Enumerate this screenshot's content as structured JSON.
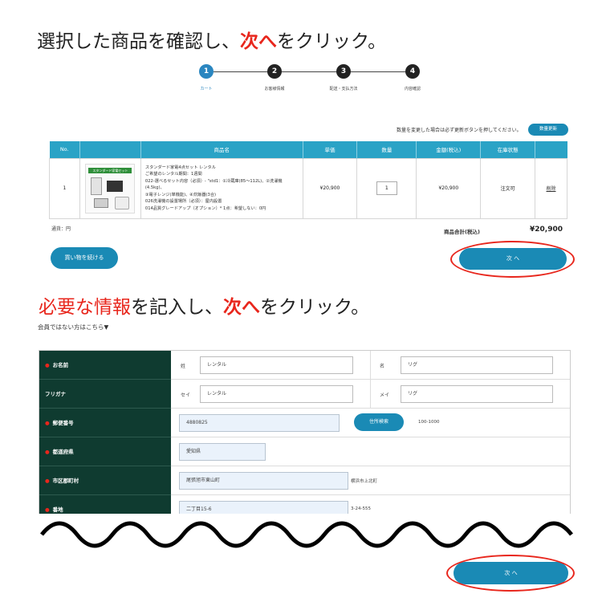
{
  "instruction1": {
    "pre": "選択した商品を確認し、",
    "highlight": "次へ",
    "post": "をクリック。"
  },
  "stepper": [
    {
      "num": "1",
      "label": "カート",
      "active": true
    },
    {
      "num": "2",
      "label": "お客様情報",
      "active": false
    },
    {
      "num": "3",
      "label": "配送・支払方法",
      "active": false
    },
    {
      "num": "4",
      "label": "内容確認",
      "active": false
    }
  ],
  "cart": {
    "update_note": "数量を変更した場合は必ず更新ボタンを押してください。",
    "update_button": "数量更新",
    "headers": [
      "No.",
      "",
      "商品名",
      "単価",
      "数量",
      "金額(税込)",
      "在庫状態",
      ""
    ],
    "row": {
      "no": "1",
      "image_label": "スタンダード家電セット",
      "description": [
        "スタンダード家電4点セット レンタル",
        "ご希望のレンタル期間：1週間",
        "022-選べるセット内容（必須）- \"std1：①冷蔵庫(85〜112L)、②洗濯機(4.5kg)、",
        "③電子レンジ(単機能)、④炊飯器(3合)",
        "026洗濯機の設置場所（必須）：屋内設置",
        "014品質グレードアップ（オプション）* 1点：希望しない：0円"
      ],
      "price": "¥20,900",
      "qty": "1",
      "amount": "¥20,900",
      "stock": "注文可",
      "action": "削除"
    },
    "currency_note": "通貨：円",
    "total_label": "商品合計(税込)",
    "total_value": "¥20,900",
    "continue_button": "買い物を続ける",
    "next_button": "次 へ"
  },
  "instruction2": {
    "pre_red": "必要な情報",
    "mid": "を記入し、",
    "highlight": "次へ",
    "post": "をクリック。"
  },
  "member_link": "会員ではない方はこちら▼",
  "form": {
    "name": {
      "label": "お名前",
      "sei_label": "姓",
      "sei_value": "レンタル",
      "mei_label": "名",
      "mei_value": "リグ"
    },
    "kana": {
      "label": "フリガナ",
      "sei_label": "セイ",
      "sei_value": "レンタル",
      "mei_label": "メイ",
      "mei_value": "リグ"
    },
    "zip": {
      "label": "郵便番号",
      "value": "4880825",
      "button": "住所検索",
      "hint": "100-1000"
    },
    "pref": {
      "label": "都道府県",
      "value": "愛知県"
    },
    "city": {
      "label": "市区郡町村",
      "value": "尾張旭市東山町",
      "hint": "横浜市上北町"
    },
    "street": {
      "label": "番地",
      "value": "二丁目15-6",
      "hint": "3-24-555"
    }
  },
  "bottom_next_button": "次 へ",
  "colors": {
    "accent": "#1a8ab5",
    "header": "#2aa3c6",
    "label_bg": "#0f3b30",
    "highlight": "#e8261c"
  }
}
